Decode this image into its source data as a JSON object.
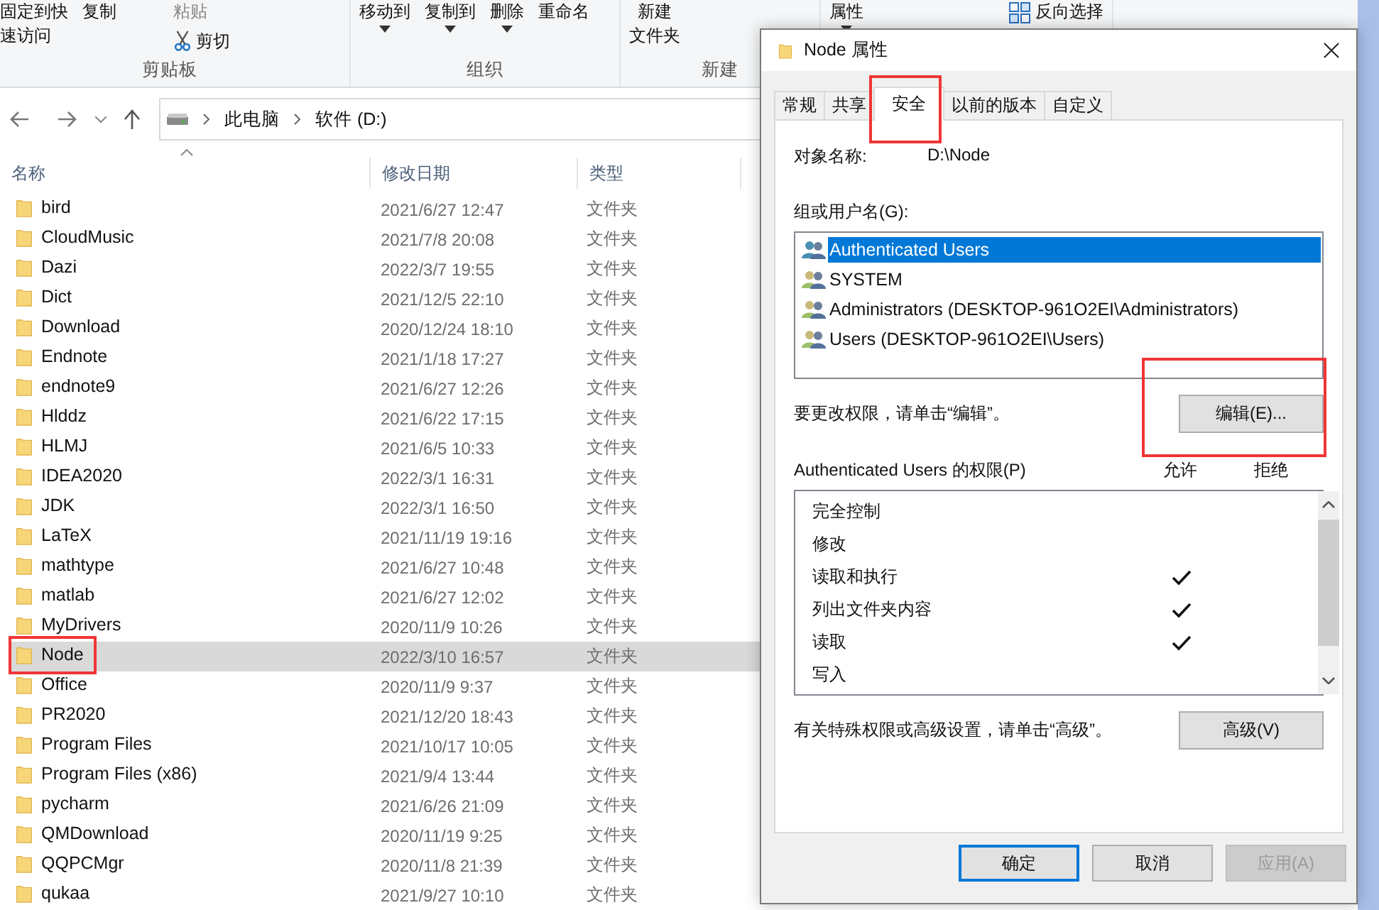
{
  "ribbon": {
    "groups": [
      {
        "label": "剪贴板",
        "columns": [
          [
            {
              "lines": [
                "固定到快",
                "速访问"
              ],
              "kind": "text",
              "dropdown": false,
              "disabled": false
            }
          ],
          [
            {
              "lines": [
                "复制"
              ],
              "kind": "text",
              "dropdown": false,
              "disabled": false
            }
          ],
          [
            {
              "lines": [
                "粘贴"
              ],
              "kind": "text",
              "dropdown": false,
              "disabled": true
            },
            {
              "lines": [
                "剪切"
              ],
              "kind": "scissors",
              "dropdown": false,
              "disabled": false
            }
          ]
        ]
      },
      {
        "label": "组织",
        "columns": [
          [
            {
              "lines": [
                "移动到"
              ],
              "kind": "text",
              "dropdown": true,
              "disabled": false
            }
          ],
          [
            {
              "lines": [
                "复制到"
              ],
              "kind": "text",
              "dropdown": true,
              "disabled": false
            }
          ],
          [
            {
              "lines": [
                "删除"
              ],
              "kind": "text",
              "dropdown": true,
              "disabled": false
            }
          ],
          [
            {
              "lines": [
                "重命名"
              ],
              "kind": "text",
              "dropdown": false,
              "disabled": false
            }
          ]
        ]
      },
      {
        "label": "新建",
        "columns": [
          [
            {
              "lines": [
                "新建",
                "文件夹"
              ],
              "kind": "text",
              "dropdown": false,
              "disabled": false
            }
          ]
        ]
      },
      {
        "columns": [
          [
            {
              "lines": [
                "属性"
              ],
              "kind": "text",
              "dropdown": true,
              "disabled": false
            }
          ]
        ]
      },
      {
        "columns": [
          [
            {
              "lines": [
                "反向选择"
              ],
              "kind": "grid",
              "dropdown": false,
              "disabled": false
            }
          ]
        ]
      }
    ]
  },
  "address": {
    "path": [
      "此电脑",
      "软件 (D:)"
    ]
  },
  "table": {
    "columns": [
      "名称",
      "修改日期",
      "类型"
    ],
    "rows": [
      {
        "name": "bird",
        "date": "2021/6/27 12:47",
        "type": "文件夹",
        "selected": false,
        "highlighted": false
      },
      {
        "name": "CloudMusic",
        "date": "2021/7/8 20:08",
        "type": "文件夹",
        "selected": false,
        "highlighted": false
      },
      {
        "name": "Dazi",
        "date": "2022/3/7 19:55",
        "type": "文件夹",
        "selected": false,
        "highlighted": false
      },
      {
        "name": "Dict",
        "date": "2021/12/5 22:10",
        "type": "文件夹",
        "selected": false,
        "highlighted": false
      },
      {
        "name": "Download",
        "date": "2020/12/24 18:10",
        "type": "文件夹",
        "selected": false,
        "highlighted": false
      },
      {
        "name": "Endnote",
        "date": "2021/1/18 17:27",
        "type": "文件夹",
        "selected": false,
        "highlighted": false
      },
      {
        "name": "endnote9",
        "date": "2021/6/27 12:26",
        "type": "文件夹",
        "selected": false,
        "highlighted": false
      },
      {
        "name": "Hlddz",
        "date": "2021/6/22 17:15",
        "type": "文件夹",
        "selected": false,
        "highlighted": false
      },
      {
        "name": "HLMJ",
        "date": "2021/6/5 10:33",
        "type": "文件夹",
        "selected": false,
        "highlighted": false
      },
      {
        "name": "IDEA2020",
        "date": "2022/3/1 16:31",
        "type": "文件夹",
        "selected": false,
        "highlighted": false
      },
      {
        "name": "JDK",
        "date": "2022/3/1 16:50",
        "type": "文件夹",
        "selected": false,
        "highlighted": false
      },
      {
        "name": "LaTeX",
        "date": "2021/11/19 19:16",
        "type": "文件夹",
        "selected": false,
        "highlighted": false
      },
      {
        "name": "mathtype",
        "date": "2021/6/27 10:48",
        "type": "文件夹",
        "selected": false,
        "highlighted": false
      },
      {
        "name": "matlab",
        "date": "2021/6/27 12:02",
        "type": "文件夹",
        "selected": false,
        "highlighted": false
      },
      {
        "name": "MyDrivers",
        "date": "2020/11/9 10:26",
        "type": "文件夹",
        "selected": false,
        "highlighted": false
      },
      {
        "name": "Node",
        "date": "2022/3/10 16:57",
        "type": "文件夹",
        "selected": true,
        "highlighted": true
      },
      {
        "name": "Office",
        "date": "2020/11/9 9:37",
        "type": "文件夹",
        "selected": false,
        "highlighted": false
      },
      {
        "name": "PR2020",
        "date": "2021/12/20 18:43",
        "type": "文件夹",
        "selected": false,
        "highlighted": false
      },
      {
        "name": "Program Files",
        "date": "2021/10/17 10:05",
        "type": "文件夹",
        "selected": false,
        "highlighted": false
      },
      {
        "name": "Program Files (x86)",
        "date": "2021/9/4 13:44",
        "type": "文件夹",
        "selected": false,
        "highlighted": false
      },
      {
        "name": "pycharm",
        "date": "2021/6/26 21:09",
        "type": "文件夹",
        "selected": false,
        "highlighted": false
      },
      {
        "name": "QMDownload",
        "date": "2020/11/19 9:25",
        "type": "文件夹",
        "selected": false,
        "highlighted": false
      },
      {
        "name": "QQPCMgr",
        "date": "2020/11/8 21:39",
        "type": "文件夹",
        "selected": false,
        "highlighted": false
      },
      {
        "name": "qukaa",
        "date": "2021/9/27 10:10",
        "type": "文件夹",
        "selected": false,
        "highlighted": false
      }
    ]
  },
  "dialog": {
    "title": "Node 属性",
    "tabs": [
      {
        "label": "常规",
        "selected": false,
        "highlighted": false
      },
      {
        "label": "共享",
        "selected": false,
        "highlighted": false
      },
      {
        "label": "安全",
        "selected": true,
        "highlighted": true
      },
      {
        "label": "以前的版本",
        "selected": false,
        "highlighted": false
      },
      {
        "label": "自定义",
        "selected": false,
        "highlighted": false
      }
    ],
    "object_label": "对象名称:",
    "object_value": "D:\\Node",
    "users_label": "组或用户名(G):",
    "users": [
      {
        "name": "Authenticated Users",
        "selected": true
      },
      {
        "name": "SYSTEM",
        "selected": false
      },
      {
        "name": "Administrators (DESKTOP-961O2EI\\Administrators)",
        "selected": false
      },
      {
        "name": "Users (DESKTOP-961O2EI\\Users)",
        "selected": false
      }
    ],
    "edit_hint": "要更改权限，请单击“编辑”。",
    "edit_button": {
      "label": "编辑(E)...",
      "highlighted": true
    },
    "permissions": {
      "label": "Authenticated Users 的权限(P)",
      "allow_label": "允许",
      "deny_label": "拒绝",
      "rows": [
        {
          "name": "完全控制",
          "allow": false,
          "deny": false
        },
        {
          "name": "修改",
          "allow": false,
          "deny": false
        },
        {
          "name": "读取和执行",
          "allow": true,
          "deny": false
        },
        {
          "name": "列出文件夹内容",
          "allow": true,
          "deny": false
        },
        {
          "name": "读取",
          "allow": true,
          "deny": false
        },
        {
          "name": "写入",
          "allow": false,
          "deny": false
        }
      ]
    },
    "advanced_hint": "有关特殊权限或高级设置，请单击“高级”。",
    "advanced_button": {
      "label": "高级(V)"
    },
    "buttons": [
      {
        "label": "确定",
        "default": true,
        "disabled": false
      },
      {
        "label": "取消",
        "default": false,
        "disabled": false
      },
      {
        "label": "应用(A)",
        "default": false,
        "disabled": true
      }
    ]
  }
}
